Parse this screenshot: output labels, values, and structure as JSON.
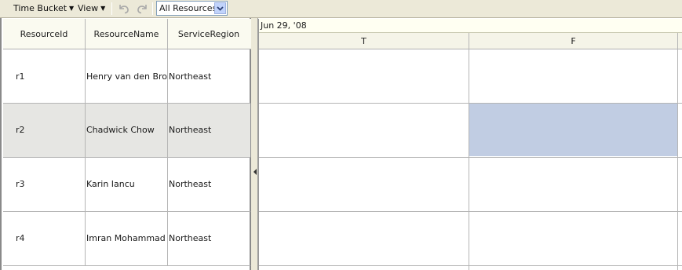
{
  "toolbar": {
    "time_bucket_label": "Time Bucket",
    "view_label": "View",
    "undo_icon": "undo-icon",
    "redo_icon": "redo-icon",
    "resource_filter": {
      "selected": "All Resources"
    }
  },
  "resource_table": {
    "columns": [
      "ResourceId",
      "ResourceName",
      "ServiceRegion"
    ],
    "rows": [
      {
        "id": "r1",
        "name": "Henry van den Broek",
        "region": "Northeast"
      },
      {
        "id": "r2",
        "name": "Chadwick Chow",
        "region": "Northeast"
      },
      {
        "id": "r3",
        "name": "Karin Iancu",
        "region": "Northeast"
      },
      {
        "id": "r4",
        "name": "Imran Mohammad",
        "region": "Northeast"
      }
    ]
  },
  "schedule": {
    "date_label": "Jun 29, '08",
    "days": [
      "T",
      "F"
    ],
    "selected_cell": {
      "row": "r2",
      "day": "F"
    },
    "colors": {
      "selection": "#c1cde3",
      "header": "#f5f4e8"
    }
  }
}
